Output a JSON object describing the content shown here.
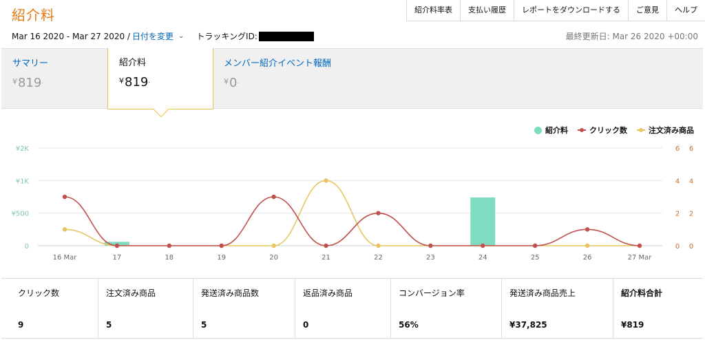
{
  "title": "紹介料",
  "nav": [
    "紹介料率表",
    "支払い履歴",
    "レポートをダウンロードする",
    "ご意見",
    "ヘルプ"
  ],
  "date_range": "Mar 16 2020 - Mar 27 2020 /",
  "change_date": "日付を変更",
  "tracking_label": "トラッキングID:",
  "last_updated": "最終更新日: Mar 26 2020 +00:00",
  "summary": {
    "summary_label": "サマリー",
    "summary_value": "819",
    "fee_label": "紹介料",
    "fee_value": "819",
    "bounty_label": "メンバー紹介イベント報酬",
    "bounty_value": "0",
    "currency": "¥"
  },
  "legend": {
    "fee": "紹介料",
    "clicks": "クリック数",
    "ordered": "注文済み商品"
  },
  "colors": {
    "fee": "#7ddcc1",
    "clicks": "#c0504d",
    "ordered": "#e8c55e",
    "left_axis": "#7ec8a9",
    "right_axis": "#c8702a",
    "title": "#e47911",
    "link": "#0066c0"
  },
  "chart_data": {
    "type": "bar+line",
    "categories": [
      "16 Mar",
      "17",
      "18",
      "19",
      "20",
      "21",
      "22",
      "23",
      "24",
      "25",
      "26",
      "27 Mar"
    ],
    "left_axis": {
      "ticks": [
        "0",
        "¥500",
        "¥1K",
        "¥2K"
      ],
      "tick_values": [
        0,
        500,
        1000,
        1500
      ],
      "ylim": [
        0,
        1500
      ]
    },
    "right_axis": {
      "ticks": [
        "0",
        "2",
        "4",
        "6"
      ],
      "ylim": [
        0,
        6
      ]
    },
    "series": [
      {
        "name": "紹介料",
        "kind": "bar",
        "axis": "left",
        "values": [
          0,
          60,
          0,
          0,
          0,
          0,
          0,
          0,
          740,
          0,
          0,
          0
        ]
      },
      {
        "name": "クリック数",
        "kind": "line",
        "axis": "right",
        "values": [
          3,
          0,
          0,
          0,
          3,
          0,
          2,
          0,
          0,
          0,
          1,
          0
        ]
      },
      {
        "name": "注文済み商品",
        "kind": "line",
        "axis": "right",
        "values": [
          1,
          0,
          0,
          0,
          0,
          4,
          0,
          0,
          0,
          0,
          0,
          0
        ]
      }
    ],
    "grid": true
  },
  "stats": [
    {
      "label": "クリック数",
      "value": "9"
    },
    {
      "label": "注文済み商品",
      "value": "5"
    },
    {
      "label": "発送済み商品数",
      "value": "5"
    },
    {
      "label": "返品済み商品",
      "value": "0"
    },
    {
      "label": "コンバージョン率",
      "value": "56%"
    },
    {
      "label": "発送済み商品売上",
      "value": "¥37,825"
    },
    {
      "label": "紹介料合計",
      "value": "¥819"
    }
  ]
}
